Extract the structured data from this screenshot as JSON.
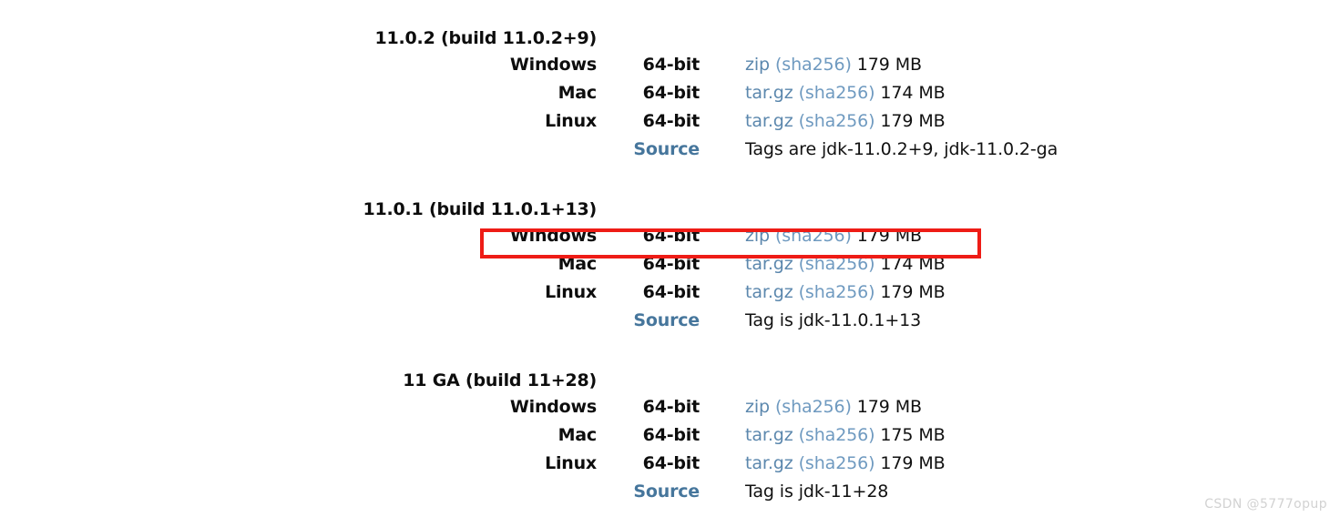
{
  "page": {
    "watermark": "CSDN @5777opup",
    "highlight_color": "#ee1c16",
    "link_color": "#5b87ad",
    "sha_color": "#6f9ac0",
    "source_color": "#46769c",
    "text_color": "#111111"
  },
  "releases": [
    {
      "heading": "11.0.2 (build 11.0.2+9)",
      "rows": [
        {
          "os": "Windows",
          "arch": "64-bit",
          "arch_is_link": false,
          "file": "zip",
          "checksum": "sha256",
          "size": "179 MB",
          "note": ""
        },
        {
          "os": "Mac",
          "arch": "64-bit",
          "arch_is_link": false,
          "file": "tar.gz",
          "checksum": "sha256",
          "size": "174 MB",
          "note": ""
        },
        {
          "os": "Linux",
          "arch": "64-bit",
          "arch_is_link": false,
          "file": "tar.gz",
          "checksum": "sha256",
          "size": "179 MB",
          "note": ""
        },
        {
          "os": "",
          "arch": "Source",
          "arch_is_link": true,
          "file": "",
          "checksum": "",
          "size": "",
          "note": "Tags are jdk-11.0.2+9, jdk-11.0.2-ga"
        }
      ]
    },
    {
      "heading": "11.0.1 (build 11.0.1+13)",
      "rows": [
        {
          "os": "Windows",
          "arch": "64-bit",
          "arch_is_link": false,
          "file": "zip",
          "checksum": "sha256",
          "size": "179 MB",
          "note": ""
        },
        {
          "os": "Mac",
          "arch": "64-bit",
          "arch_is_link": false,
          "file": "tar.gz",
          "checksum": "sha256",
          "size": "174 MB",
          "note": ""
        },
        {
          "os": "Linux",
          "arch": "64-bit",
          "arch_is_link": false,
          "file": "tar.gz",
          "checksum": "sha256",
          "size": "179 MB",
          "note": ""
        },
        {
          "os": "",
          "arch": "Source",
          "arch_is_link": true,
          "file": "",
          "checksum": "",
          "size": "",
          "note": "Tag is jdk-11.0.1+13"
        }
      ]
    },
    {
      "heading": "11 GA (build 11+28)",
      "rows": [
        {
          "os": "Windows",
          "arch": "64-bit",
          "arch_is_link": false,
          "file": "zip",
          "checksum": "sha256",
          "size": "179 MB",
          "note": ""
        },
        {
          "os": "Mac",
          "arch": "64-bit",
          "arch_is_link": false,
          "file": "tar.gz",
          "checksum": "sha256",
          "size": "175 MB",
          "note": ""
        },
        {
          "os": "Linux",
          "arch": "64-bit",
          "arch_is_link": false,
          "file": "tar.gz",
          "checksum": "sha256",
          "size": "179 MB",
          "note": ""
        },
        {
          "os": "",
          "arch": "Source",
          "arch_is_link": true,
          "file": "",
          "checksum": "",
          "size": "",
          "note": "Tag is jdk-11+28"
        }
      ]
    }
  ]
}
